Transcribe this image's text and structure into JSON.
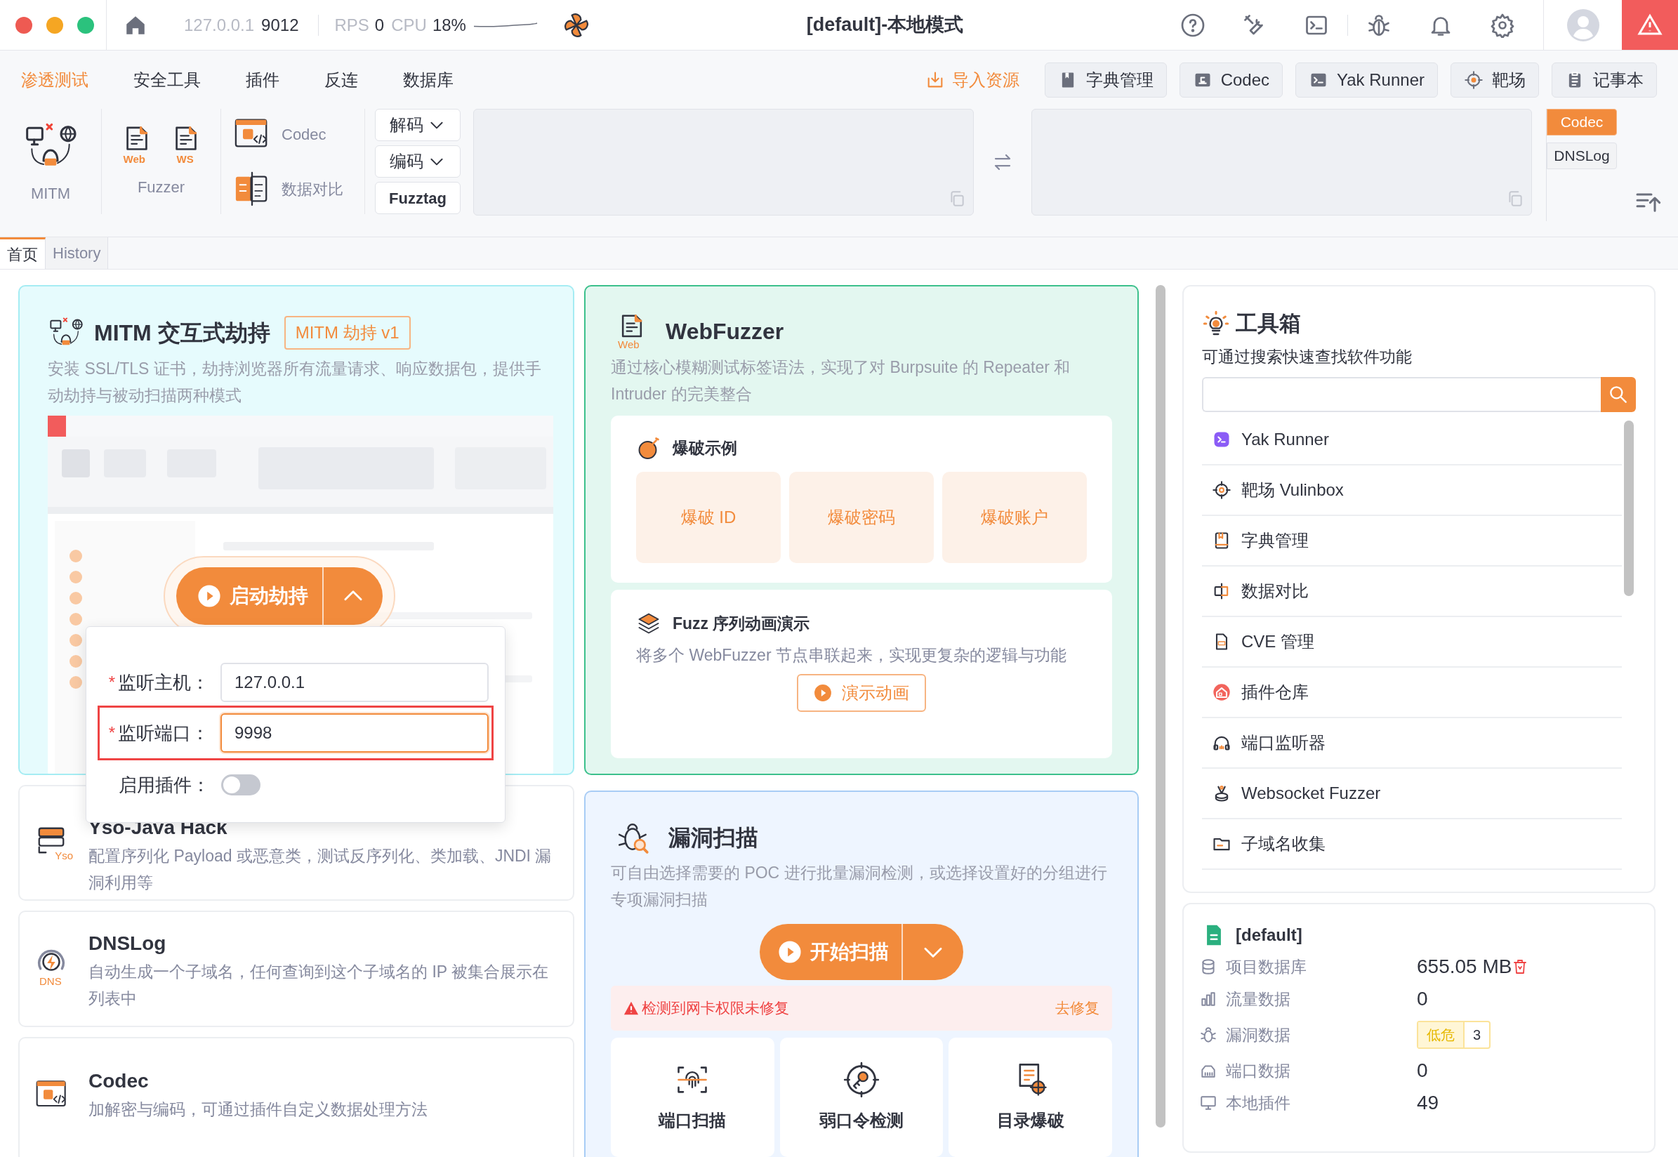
{
  "title_bar": {
    "host": "127.0.0.1",
    "port": "9012",
    "rps_label": "RPS",
    "rps": "0",
    "cpu_label": "CPU",
    "cpu": "18%",
    "title": "[default]-本地模式"
  },
  "menu": [
    {
      "label": "渗透测试",
      "selected": true
    },
    {
      "label": "安全工具",
      "selected": false
    },
    {
      "label": "插件",
      "selected": false
    },
    {
      "label": "反连",
      "selected": false
    },
    {
      "label": "数据库",
      "selected": false
    }
  ],
  "import_link": "导入资源",
  "quick_buttons": [
    {
      "label": "字典管理",
      "kind": "book"
    },
    {
      "label": "Codec",
      "kind": "codec"
    },
    {
      "label": "Yak Runner",
      "kind": "terminal"
    },
    {
      "label": "靶场",
      "kind": "target"
    },
    {
      "label": "记事本",
      "kind": "notes"
    }
  ],
  "toolbar": {
    "mitm": "MITM",
    "web": "Web",
    "ws": "WS",
    "fuzzer": "Fuzzer",
    "codec": "Codec",
    "compare": "数据对比",
    "decode": "解码",
    "encode": "编码",
    "fuzztag": "Fuzztag"
  },
  "side_tabs": [
    {
      "label": "Codec",
      "selected": true
    },
    {
      "label": "DNSLog",
      "selected": false
    }
  ],
  "page_tabs": [
    {
      "label": "首页",
      "selected": true
    },
    {
      "label": "History",
      "selected": false
    }
  ],
  "mitm": {
    "title": "MITM 交互式劫持",
    "badge": "MITM 劫持 v1",
    "desc": "安装 SSL/TLS 证书，劫持浏览器所有流量请求、响应数据包，提供手动劫持与被动扫描两种模式",
    "start": "启动劫持",
    "fields": [
      {
        "mark": "*",
        "label": "监听主机：",
        "value": "127.0.0.1",
        "highlighted": false
      },
      {
        "mark": "*",
        "label": "监听端口：",
        "value": "9998",
        "highlighted": true
      }
    ],
    "plugins": {
      "label": "启用插件：",
      "on": false
    }
  },
  "left_cards": [
    {
      "kind": "yso",
      "icon_text": "Yso",
      "title": "Yso-Java Hack",
      "desc": "配置序列化 Payload 或恶意类，测试反序列化、类加载、JNDI 漏洞利用等"
    },
    {
      "kind": "dns",
      "icon_text": "DNS",
      "title": "DNSLog",
      "desc": "自动生成一个子域名，任何查询到这个子域名的 IP 被集合展示在列表中"
    },
    {
      "kind": "codec",
      "title": "Codec",
      "desc": "加解密与编码，可通过插件自定义数据处理方法"
    }
  ],
  "webfuzzer": {
    "icon_text": "Web",
    "title": "WebFuzzer",
    "desc": "通过核心模糊测试标签语法，实现了对 Burpsuite 的 Repeater 和 Intruder 的完美整合",
    "examples": {
      "title": "爆破示例",
      "items": [
        "爆破 ID",
        "爆破密码",
        "爆破账户"
      ]
    },
    "sequence": {
      "title": "Fuzz 序列动画演示",
      "desc": "将多个 WebFuzzer 节点串联起来，实现更复杂的逻辑与功能",
      "button": "演示动画"
    }
  },
  "vuln_scan": {
    "title": "漏洞扫描",
    "desc": "可自由选择需要的 POC 进行批量漏洞检测，或选择设置好的分组进行专项漏洞扫描",
    "start": "开始扫描",
    "warning": "检测到网卡权限未修复",
    "fix": "去修复",
    "tools": [
      {
        "label": "端口扫描",
        "kind": "port"
      },
      {
        "label": "弱口令检测",
        "kind": "key"
      },
      {
        "label": "目录爆破",
        "kind": "dir"
      }
    ]
  },
  "toolbox": {
    "title": "工具箱",
    "subtitle": "可通过搜索快速查找软件功能",
    "items": [
      {
        "label": "Yak Runner",
        "kind": "yak"
      },
      {
        "label": "靶场 Vulinbox",
        "kind": "target"
      },
      {
        "label": "字典管理",
        "kind": "book"
      },
      {
        "label": "数据对比",
        "kind": "compare"
      },
      {
        "label": "CVE 管理",
        "kind": "cve"
      },
      {
        "label": "插件仓库",
        "kind": "store"
      },
      {
        "label": "端口监听器",
        "kind": "headphone"
      },
      {
        "label": "Websocket Fuzzer",
        "kind": "ws"
      },
      {
        "label": "子域名收集",
        "kind": "folder"
      }
    ]
  },
  "project": {
    "name": "[default]",
    "rows": [
      {
        "kind": "db",
        "label": "项目数据库",
        "value": "655.05 MB"
      },
      {
        "kind": "traffic",
        "label": "流量数据",
        "value": "0"
      },
      {
        "kind": "vuln",
        "label": "漏洞数据",
        "tag": "低危",
        "count": "3"
      },
      {
        "kind": "port",
        "label": "端口数据",
        "value": "0"
      },
      {
        "kind": "plugin",
        "label": "本地插件",
        "value": "49"
      }
    ]
  }
}
